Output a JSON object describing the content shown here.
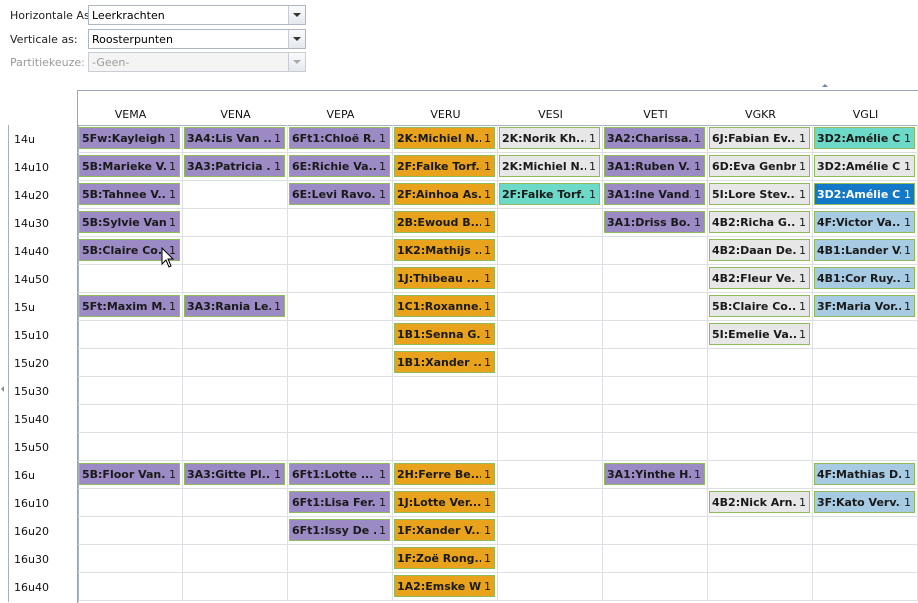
{
  "form": {
    "horizontal_label": "Horizontale As:",
    "horizontal_value": "Leerkrachten",
    "vertical_label": "Verticale as:",
    "vertical_value": "Roosterpunten",
    "partition_label": "Partitiekeuze:",
    "partition_value": "-Geen-"
  },
  "columns": [
    "VEMA",
    "VENA",
    "VEPA",
    "VERU",
    "VESI",
    "VETI",
    "VGKR",
    "VGLI"
  ],
  "colors": {
    "purple": "#9b8ac4",
    "orange": "#e8a21c",
    "gray": "#e7e7e7",
    "teal": "#6dd9c9",
    "lightblue": "#a6cbe3",
    "blue": "#1478c8",
    "border": "#8fba5c"
  },
  "rows": [
    {
      "time": "14u",
      "cells": [
        {
          "c": 0,
          "text": "5Fw:Kayleigh...",
          "count": "1",
          "color": "purple"
        },
        {
          "c": 1,
          "text": "3A4:Lis Van ...",
          "count": "1",
          "color": "purple"
        },
        {
          "c": 2,
          "text": "6Ft1:Chloë R...",
          "count": "1",
          "color": "purple"
        },
        {
          "c": 3,
          "text": "2K:Michiel N...",
          "count": "1",
          "color": "orange"
        },
        {
          "c": 4,
          "text": "2K:Norik Kh...",
          "count": "1",
          "color": "gray"
        },
        {
          "c": 5,
          "text": "3A2:Charissa...",
          "count": "1",
          "color": "purple"
        },
        {
          "c": 6,
          "text": "6J:Fabian Ev...",
          "count": "1",
          "color": "gray"
        },
        {
          "c": 7,
          "text": "3D2:Amélie C...",
          "count": "1",
          "color": "teal"
        }
      ]
    },
    {
      "time": "14u10",
      "cells": [
        {
          "c": 0,
          "text": "5B:Marieke V...",
          "count": "1",
          "color": "purple"
        },
        {
          "c": 1,
          "text": "3A3:Patricia ...",
          "count": "1",
          "color": "purple"
        },
        {
          "c": 2,
          "text": "6E:Richie Va...",
          "count": "1",
          "color": "purple"
        },
        {
          "c": 3,
          "text": "2F:Falke Torf...",
          "count": "1",
          "color": "orange"
        },
        {
          "c": 4,
          "text": "2K:Michiel N...",
          "count": "1",
          "color": "gray"
        },
        {
          "c": 5,
          "text": "3A1:Ruben V...",
          "count": "1",
          "color": "purple"
        },
        {
          "c": 6,
          "text": "6D:Eva Genbr...",
          "count": "1",
          "color": "gray"
        },
        {
          "c": 7,
          "text": "3D2:Amélie C...",
          "count": "1",
          "color": "gray"
        }
      ]
    },
    {
      "time": "14u20",
      "cells": [
        {
          "c": 0,
          "text": "5B:Tahnee V...",
          "count": "1",
          "color": "purple"
        },
        {
          "c": 2,
          "text": "6E:Levi Ravo...",
          "count": "1",
          "color": "purple"
        },
        {
          "c": 3,
          "text": "2F:Ainhoa As...",
          "count": "1",
          "color": "orange"
        },
        {
          "c": 4,
          "text": "2F:Falke Torf...",
          "count": "1",
          "color": "teal"
        },
        {
          "c": 5,
          "text": "3A1:Ine Vand...",
          "count": "1",
          "color": "purple"
        },
        {
          "c": 6,
          "text": "5I:Lore Stev...",
          "count": "1",
          "color": "gray"
        },
        {
          "c": 7,
          "text": "3D2:Amélie C...",
          "count": "1",
          "color": "blue"
        }
      ]
    },
    {
      "time": "14u30",
      "cells": [
        {
          "c": 0,
          "text": "5B:Sylvie Van...",
          "count": "1",
          "color": "purple"
        },
        {
          "c": 3,
          "text": "2B:Ewoud B...",
          "count": "1",
          "color": "orange"
        },
        {
          "c": 5,
          "text": "3A1:Driss Bo...",
          "count": "1",
          "color": "purple"
        },
        {
          "c": 6,
          "text": "4B2:Richa G...",
          "count": "1",
          "color": "gray"
        },
        {
          "c": 7,
          "text": "4F:Victor Va...",
          "count": "1",
          "color": "lightblue"
        }
      ]
    },
    {
      "time": "14u40",
      "cells": [
        {
          "c": 0,
          "text": "5B:Claire Co...",
          "count": "1",
          "color": "purple"
        },
        {
          "c": 3,
          "text": "1K2:Mathijs ...",
          "count": "1",
          "color": "orange"
        },
        {
          "c": 6,
          "text": "4B2:Daan De...",
          "count": "1",
          "color": "gray"
        },
        {
          "c": 7,
          "text": "4B1:Lander V...",
          "count": "1",
          "color": "lightblue"
        }
      ]
    },
    {
      "time": "14u50",
      "cells": [
        {
          "c": 3,
          "text": "1J:Thibeau ...",
          "count": "1",
          "color": "orange"
        },
        {
          "c": 6,
          "text": "4B2:Fleur Ve...",
          "count": "1",
          "color": "gray"
        },
        {
          "c": 7,
          "text": "4B1:Cor Ruy...",
          "count": "1",
          "color": "lightblue"
        }
      ]
    },
    {
      "time": "15u",
      "cells": [
        {
          "c": 0,
          "text": "5Ft:Maxim M...",
          "count": "1",
          "color": "purple"
        },
        {
          "c": 1,
          "text": "3A3:Rania Le...",
          "count": "1",
          "color": "purple"
        },
        {
          "c": 3,
          "text": "1C1:Roxanne...",
          "count": "1",
          "color": "orange"
        },
        {
          "c": 6,
          "text": "5B:Claire Co...",
          "count": "1",
          "color": "gray"
        },
        {
          "c": 7,
          "text": "3F:Maria Vor...",
          "count": "1",
          "color": "lightblue"
        }
      ]
    },
    {
      "time": "15u10",
      "cells": [
        {
          "c": 3,
          "text": "1B1:Senna G...",
          "count": "1",
          "color": "orange"
        },
        {
          "c": 6,
          "text": "5I:Emelie Va...",
          "count": "1",
          "color": "gray"
        }
      ]
    },
    {
      "time": "15u20",
      "cells": [
        {
          "c": 3,
          "text": "1B1:Xander ...",
          "count": "1",
          "color": "orange"
        }
      ]
    },
    {
      "time": "15u30",
      "cells": []
    },
    {
      "time": "15u40",
      "cells": []
    },
    {
      "time": "15u50",
      "cells": []
    },
    {
      "time": "16u",
      "cells": [
        {
          "c": 0,
          "text": "5B:Floor Van...",
          "count": "1",
          "color": "purple"
        },
        {
          "c": 1,
          "text": "3A3:Gitte Pl...",
          "count": "1",
          "color": "purple"
        },
        {
          "c": 2,
          "text": "6Ft1:Lotte ...",
          "count": "1",
          "color": "purple"
        },
        {
          "c": 3,
          "text": "2H:Ferre Be...",
          "count": "1",
          "color": "orange"
        },
        {
          "c": 5,
          "text": "3A1:Yinthe H...",
          "count": "1",
          "color": "purple"
        },
        {
          "c": 7,
          "text": "4F:Mathias D...",
          "count": "1",
          "color": "lightblue"
        }
      ]
    },
    {
      "time": "16u10",
      "cells": [
        {
          "c": 2,
          "text": "6Ft1:Lisa Fer...",
          "count": "1",
          "color": "purple"
        },
        {
          "c": 3,
          "text": "1J:Lotte Ver...",
          "count": "1",
          "color": "orange"
        },
        {
          "c": 6,
          "text": "4B2:Nick Arn...",
          "count": "1",
          "color": "gray"
        },
        {
          "c": 7,
          "text": "3F:Kato Verv...",
          "count": "1",
          "color": "lightblue"
        }
      ]
    },
    {
      "time": "16u20",
      "cells": [
        {
          "c": 2,
          "text": "6Ft1:Issy De ...",
          "count": "1",
          "color": "purple"
        },
        {
          "c": 3,
          "text": "1F:Xander V...",
          "count": "1",
          "color": "orange"
        }
      ]
    },
    {
      "time": "16u30",
      "cells": [
        {
          "c": 3,
          "text": "1F:Zoë Rong...",
          "count": "1",
          "color": "orange"
        }
      ]
    },
    {
      "time": "16u40",
      "cells": [
        {
          "c": 3,
          "text": "1A2:Emske W...",
          "count": "1",
          "color": "orange"
        }
      ]
    }
  ]
}
